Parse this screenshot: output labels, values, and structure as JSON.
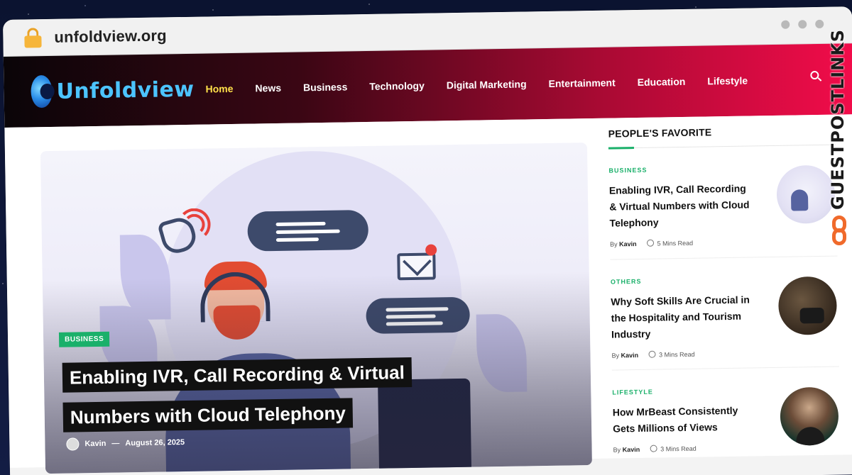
{
  "browser": {
    "url": "unfoldview.org"
  },
  "header": {
    "logo_text": "Unfoldview",
    "nav": [
      {
        "label": "Home",
        "active": true
      },
      {
        "label": "News",
        "active": false
      },
      {
        "label": "Business",
        "active": false
      },
      {
        "label": "Technology",
        "active": false
      },
      {
        "label": "Digital Marketing",
        "active": false
      },
      {
        "label": "Entertainment",
        "active": false
      },
      {
        "label": "Education",
        "active": false
      },
      {
        "label": "Lifestyle",
        "active": false
      }
    ]
  },
  "hero": {
    "category": "BUSINESS",
    "title": "Enabling IVR, Call Recording & Virtual Numbers with Cloud Telephony",
    "author": "Kavin",
    "separator": "—",
    "date": "August 26, 2025"
  },
  "sidebar": {
    "title": "PEOPLE'S FAVORITE",
    "by_label": "By",
    "posts": [
      {
        "category": "BUSINESS",
        "title": "Enabling IVR, Call Recording & Virtual Numbers with Cloud Telephony",
        "author": "Kavin",
        "read_time": "5 Mins Read"
      },
      {
        "category": "OTHERS",
        "title": "Why Soft Skills Are Crucial in the Hospitality and Tourism Industry",
        "author": "Kavin",
        "read_time": "3 Mins Read"
      },
      {
        "category": "LIFESTYLE",
        "title": "How MrBeast Consistently Gets Millions of Views",
        "author": "Kavin",
        "read_time": "3 Mins Read"
      }
    ]
  },
  "watermark": {
    "text": "GUESTPOSTLINKS"
  },
  "colors": {
    "accent_green": "#1ab06a",
    "nav_active": "#ffe14a",
    "header_end": "#f20c4a"
  }
}
